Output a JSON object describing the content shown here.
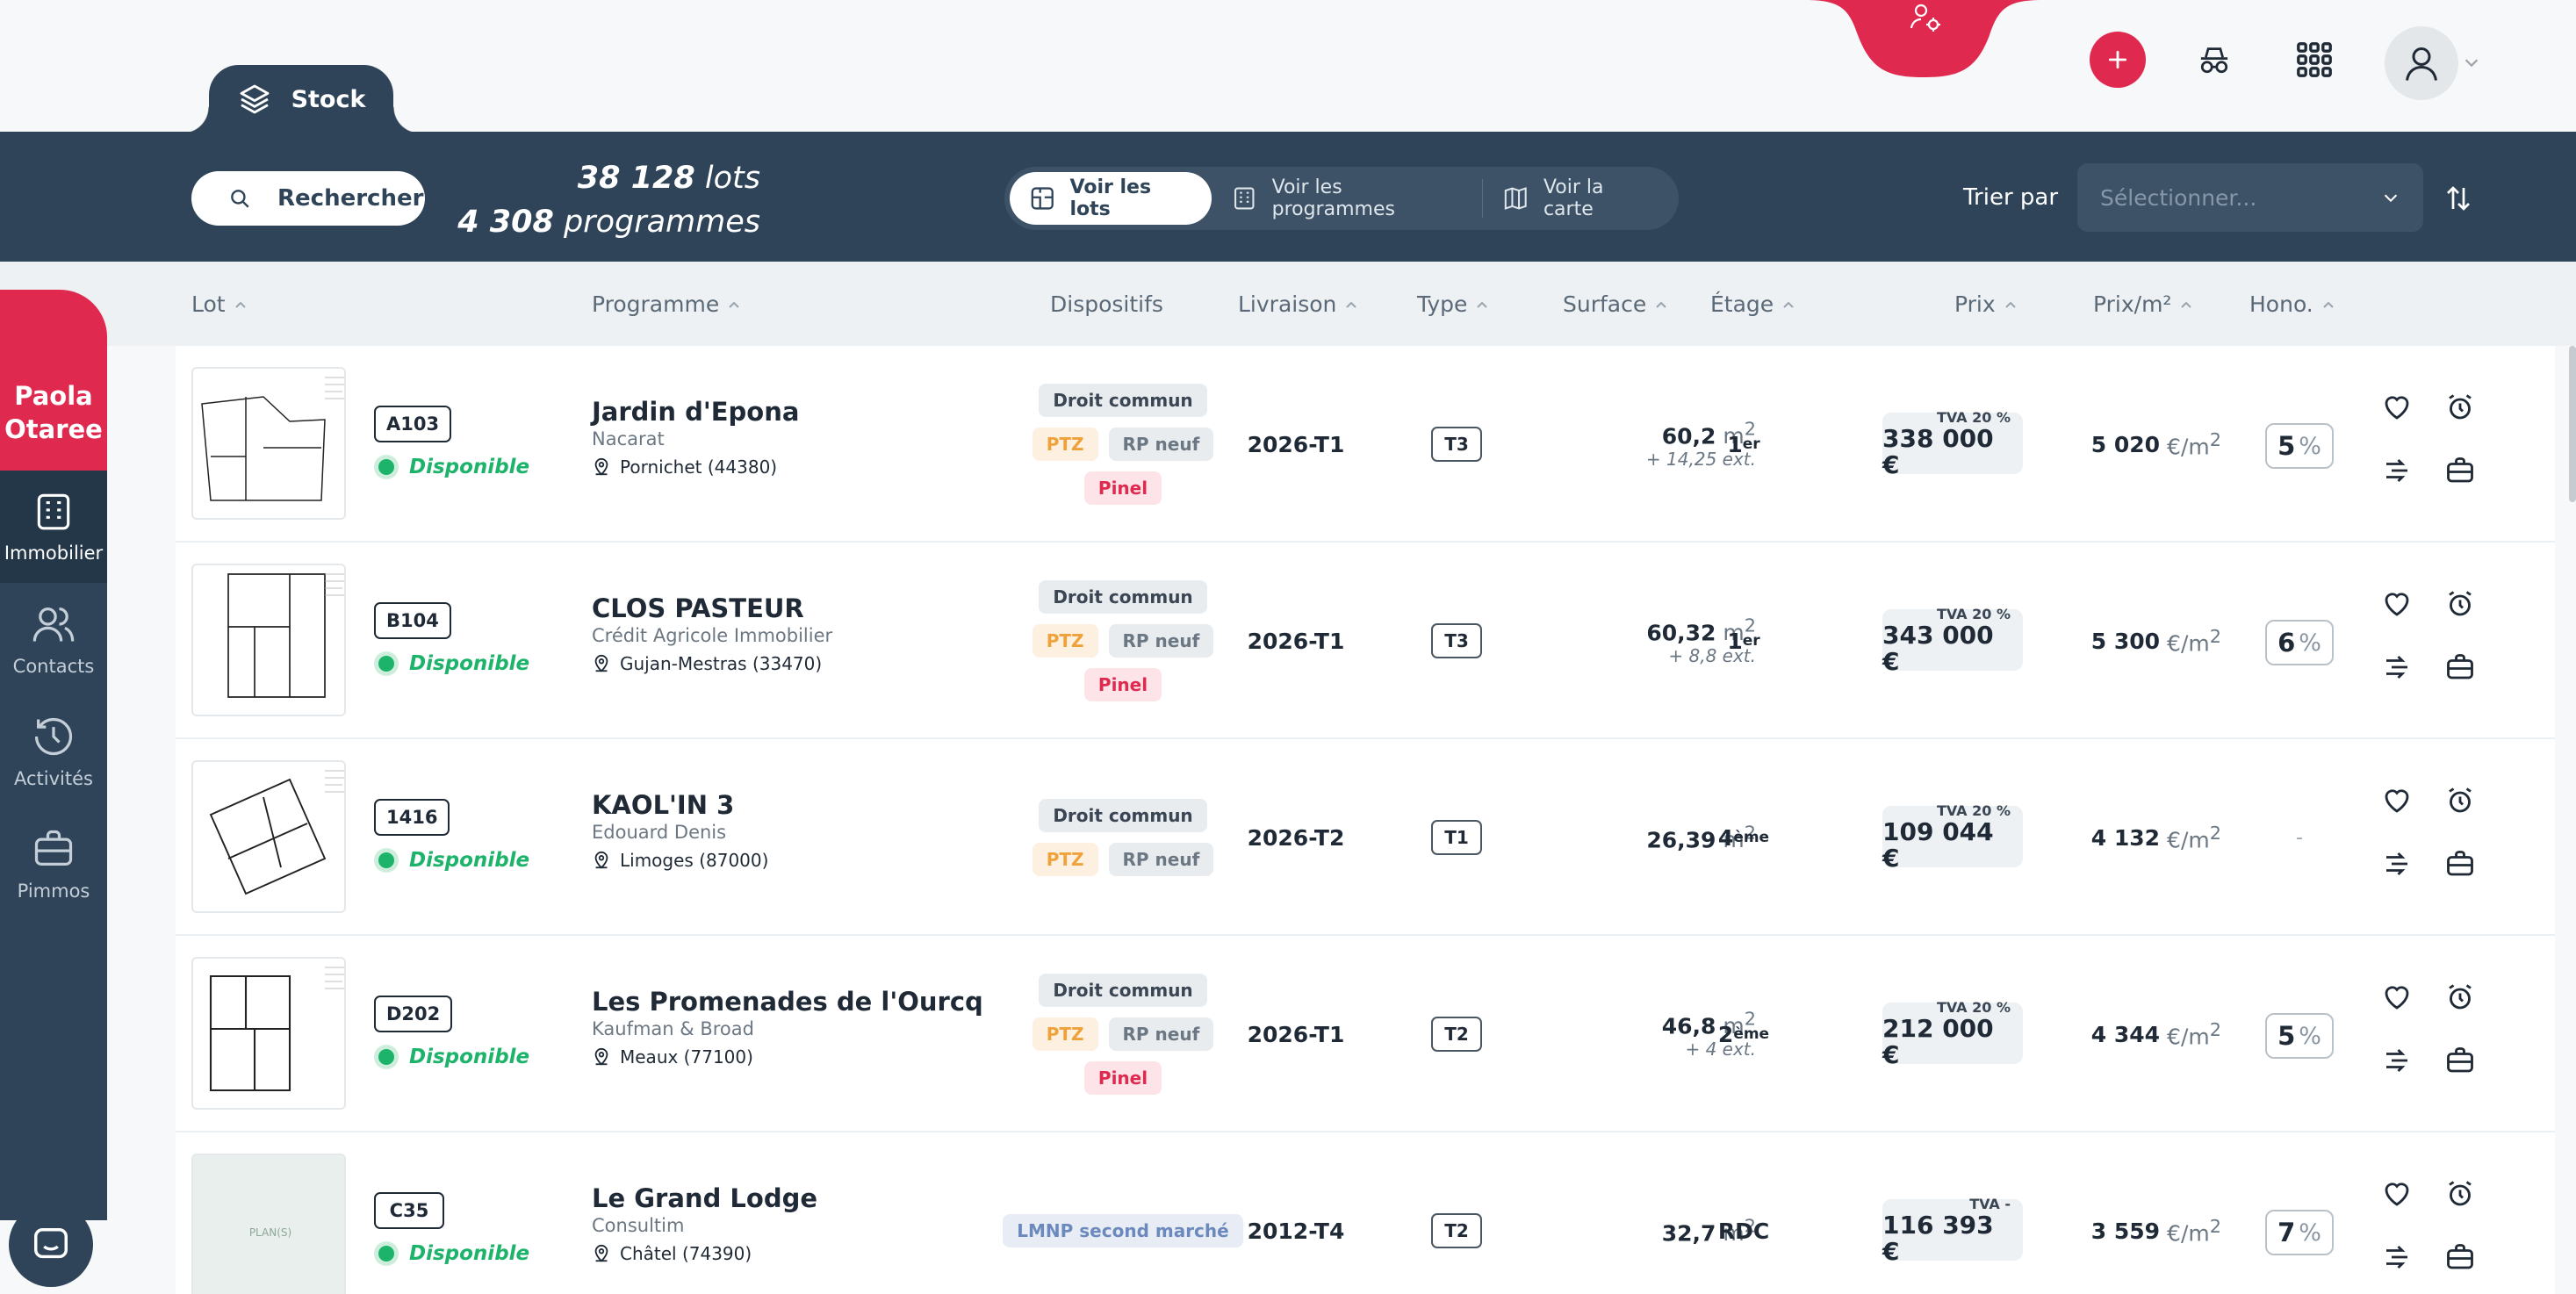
{
  "header": {
    "tab_label": "Stock",
    "icons": [
      "layers-icon",
      "user-network-icon",
      "plus-icon",
      "spy-icon",
      "apps-grid-icon",
      "user-icon",
      "chevron-down-icon"
    ]
  },
  "toolbar": {
    "search_label": "Rechercher",
    "lots_count": "38 128",
    "lots_label": "lots",
    "programmes_count": "4 308",
    "programmes_label": "programmes",
    "views": [
      "Voir les lots",
      "Voir les programmes",
      "Voir la carte"
    ],
    "sort_label": "Trier par",
    "sort_placeholder": "Sélectionner..."
  },
  "sidebar": {
    "user_first": "Paola",
    "user_last": "Otaree",
    "items": [
      {
        "label": "Immobilier",
        "icon": "building-icon",
        "active": true
      },
      {
        "label": "Contacts",
        "icon": "contacts-icon",
        "active": false
      },
      {
        "label": "Activités",
        "icon": "history-icon",
        "active": false
      },
      {
        "label": "Pimmos",
        "icon": "briefcase-icon",
        "active": false
      }
    ]
  },
  "columns": [
    "Lot",
    "Programme",
    "Dispositifs",
    "Livraison",
    "Type",
    "Surface",
    "Étage",
    "Prix",
    "Prix/m²",
    "Hono."
  ],
  "rows": [
    {
      "lot": "A103",
      "status": "Disponible",
      "programme": "Jardin d'Epona",
      "developer": "Nacarat",
      "location": "Pornichet (44380)",
      "tags": [
        [
          "Droit commun"
        ],
        [
          "PTZ",
          "RP neuf"
        ],
        [
          "Pinel"
        ]
      ],
      "livraison": "2026-T1",
      "type": "T3",
      "surface": "60,2",
      "surface_ext": "+ 14,25",
      "etage": "1",
      "etage_sup": "er",
      "tva": "TVA 20 %",
      "prix": "338 000 €",
      "ppm": "5 020",
      "hono": "5"
    },
    {
      "lot": "B104",
      "status": "Disponible",
      "programme": "CLOS PASTEUR",
      "developer": "Crédit Agricole Immobilier",
      "location": "Gujan-Mestras (33470)",
      "tags": [
        [
          "Droit commun"
        ],
        [
          "PTZ",
          "RP neuf"
        ],
        [
          "Pinel"
        ]
      ],
      "livraison": "2026-T1",
      "type": "T3",
      "surface": "60,32",
      "surface_ext": "+ 8,8",
      "etage": "1",
      "etage_sup": "er",
      "tva": "TVA 20 %",
      "prix": "343 000 €",
      "ppm": "5 300",
      "hono": "6"
    },
    {
      "lot": "1416",
      "status": "Disponible",
      "programme": "KAOL'IN 3",
      "developer": "Edouard Denis",
      "location": "Limoges (87000)",
      "tags": [
        [
          "Droit commun"
        ],
        [
          "PTZ",
          "RP neuf"
        ]
      ],
      "livraison": "2026-T2",
      "type": "T1",
      "surface": "26,39",
      "surface_ext": "",
      "etage": "4",
      "etage_sup": "ème",
      "tva": "TVA 20 %",
      "prix": "109 044 €",
      "ppm": "4 132",
      "hono": "-"
    },
    {
      "lot": "D202",
      "status": "Disponible",
      "programme": "Les Promenades de l'Ourcq",
      "developer": "Kaufman & Broad",
      "location": "Meaux (77100)",
      "tags": [
        [
          "Droit commun"
        ],
        [
          "PTZ",
          "RP neuf"
        ],
        [
          "Pinel"
        ]
      ],
      "livraison": "2026-T1",
      "type": "T2",
      "surface": "46,8",
      "surface_ext": "+ 4",
      "etage": "2",
      "etage_sup": "ème",
      "tva": "TVA 20 %",
      "prix": "212 000 €",
      "ppm": "4 344",
      "hono": "5"
    },
    {
      "lot": "C35",
      "status": "Disponible",
      "programme": "Le Grand Lodge",
      "developer": "Consultim",
      "location": "Châtel (74390)",
      "tags": [
        [
          "LMNP second marché"
        ]
      ],
      "livraison": "2012-T4",
      "type": "T2",
      "surface": "32,7",
      "surface_ext": "",
      "etage": "RDC",
      "etage_sup": "",
      "tva": "TVA -",
      "prix": "116 393 €",
      "ppm": "3 559",
      "hono": "7"
    }
  ],
  "units": {
    "m2": "m",
    "m2_sup": "2",
    "ext": "ext.",
    "ppm_unit": "€/m",
    "pct": "%"
  },
  "placeholder_text": "PLAN(S)",
  "colors": {
    "brand_pink": "#e0294f",
    "navy": "#2f4458",
    "available_green": "#1db36b"
  }
}
